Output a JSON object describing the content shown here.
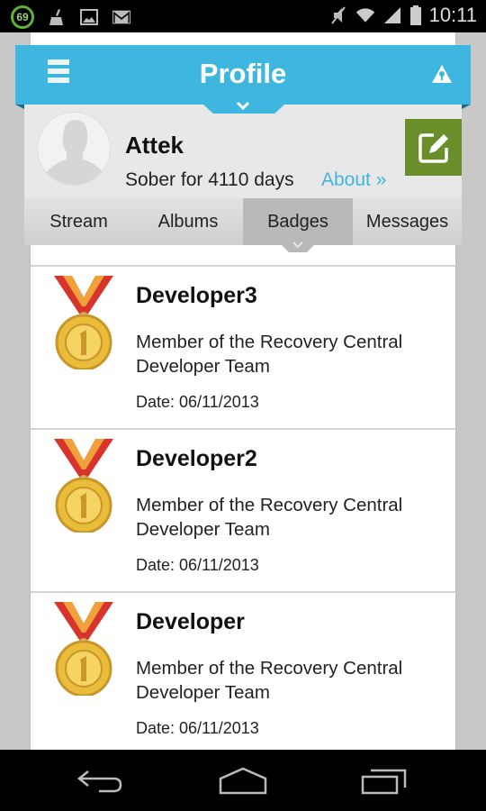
{
  "status_bar": {
    "battery_level_badge": "69",
    "time": "10:11",
    "left_icons": [
      "battery-saver-badge",
      "cleaner-icon",
      "gallery-icon",
      "gmail-icon"
    ],
    "right_icons": [
      "mute-icon",
      "wifi-icon",
      "signal-icon",
      "battery-icon"
    ]
  },
  "action_bar": {
    "title": "Profile",
    "accent_color": "#3fb6e0",
    "menu_icon": "hamburger-menu-icon",
    "alert_icon": "alert-triangle-icon"
  },
  "profile": {
    "name": "Attek",
    "sober_text": "Sober for 4110 days",
    "about_link": "About »",
    "edit_button_color": "#6a8f2a"
  },
  "tabs": [
    {
      "label": "Stream",
      "active": false
    },
    {
      "label": "Albums",
      "active": false
    },
    {
      "label": "Badges",
      "active": true
    },
    {
      "label": "Messages",
      "active": false
    }
  ],
  "badges": [
    {
      "title": "Developer3",
      "description": "Member of the Recovery Central Developer Team",
      "date": "Date: 06/11/2013"
    },
    {
      "title": "Developer2",
      "description": "Member of the Recovery Central Developer Team",
      "date": "Date: 06/11/2013"
    },
    {
      "title": "Developer",
      "description": "Member of the Recovery Central Developer Team",
      "date": "Date: 06/11/2013"
    }
  ],
  "nav_bar": {
    "buttons": [
      "back",
      "home",
      "recents"
    ]
  }
}
